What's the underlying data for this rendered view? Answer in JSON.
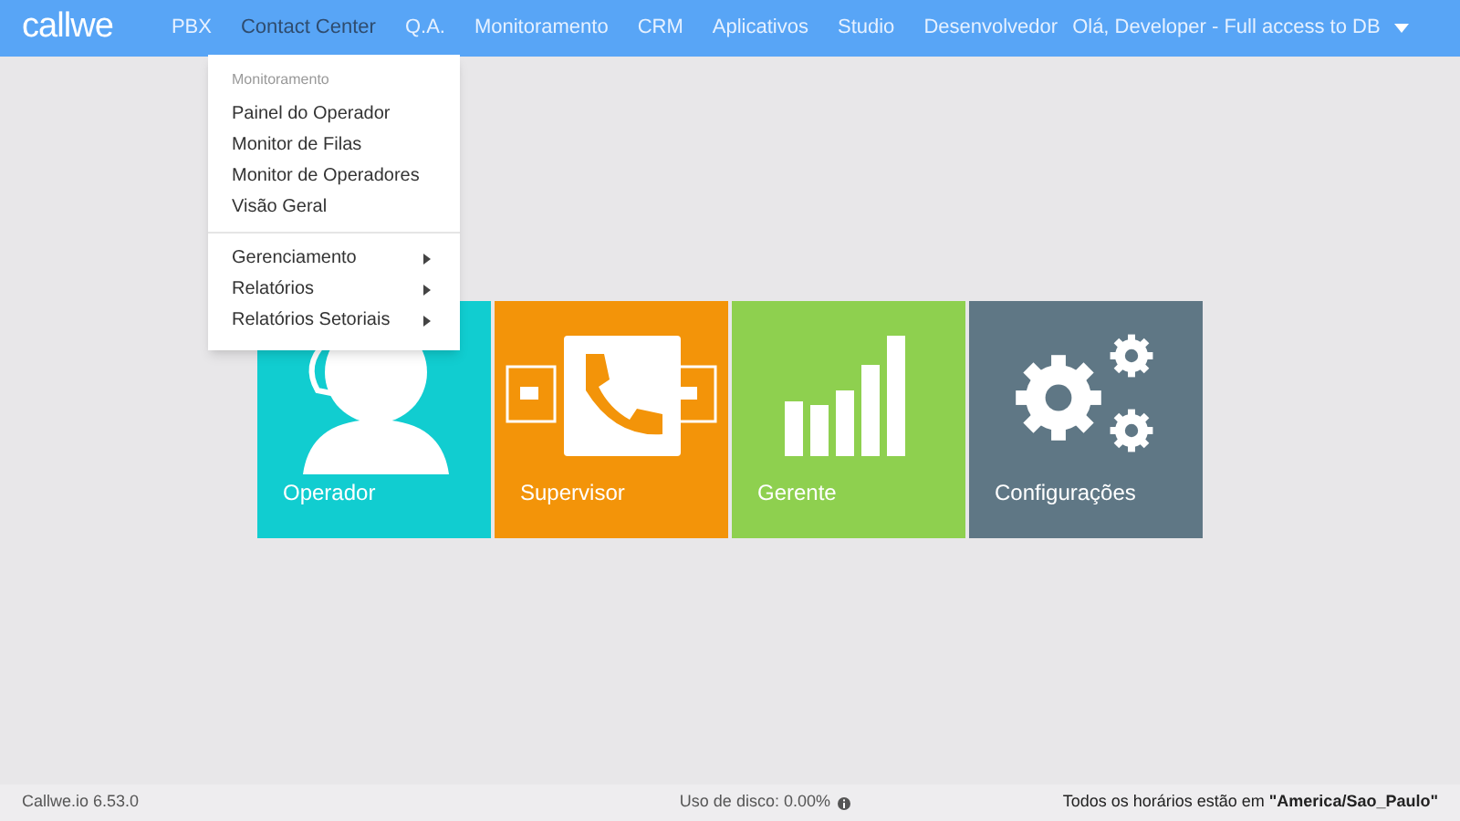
{
  "navbar": {
    "logo": "callwe",
    "items": [
      {
        "label": "PBX",
        "selected": false
      },
      {
        "label": "Contact Center",
        "selected": true
      },
      {
        "label": "Q.A.",
        "selected": false
      },
      {
        "label": "Monitoramento",
        "selected": false
      },
      {
        "label": "CRM",
        "selected": false
      },
      {
        "label": "Aplicativos",
        "selected": false
      },
      {
        "label": "Studio",
        "selected": false
      },
      {
        "label": "Desenvolvedor",
        "selected": false
      }
    ],
    "user": "Olá, Developer - Full access to DB"
  },
  "dropdown": {
    "header": "Monitoramento",
    "items": [
      {
        "label": "Painel do Operador",
        "submenu": false
      },
      {
        "label": "Monitor de Filas",
        "submenu": false
      },
      {
        "label": "Monitor de Operadores",
        "submenu": false
      },
      {
        "label": "Visão Geral",
        "submenu": false
      }
    ],
    "groups": [
      {
        "label": "Gerenciamento",
        "submenu": true
      },
      {
        "label": "Relatórios",
        "submenu": true
      },
      {
        "label": "Relatórios Setoriais",
        "submenu": true
      }
    ]
  },
  "tiles": [
    {
      "label": "Operador",
      "kind": "operator",
      "color": "#11cdd0"
    },
    {
      "label": "Supervisor",
      "kind": "supervisor",
      "color": "#f39409"
    },
    {
      "label": "Gerente",
      "kind": "manager",
      "color": "#8ed04f"
    },
    {
      "label": "Configurações",
      "kind": "settings",
      "color": "#5f7785"
    }
  ],
  "footer": {
    "version": "Callwe.io 6.53.0",
    "disk": "Uso de disco: 0.00%",
    "timezone": "Todos os horários estão em **\"America/Sao_Paulo\"**"
  }
}
